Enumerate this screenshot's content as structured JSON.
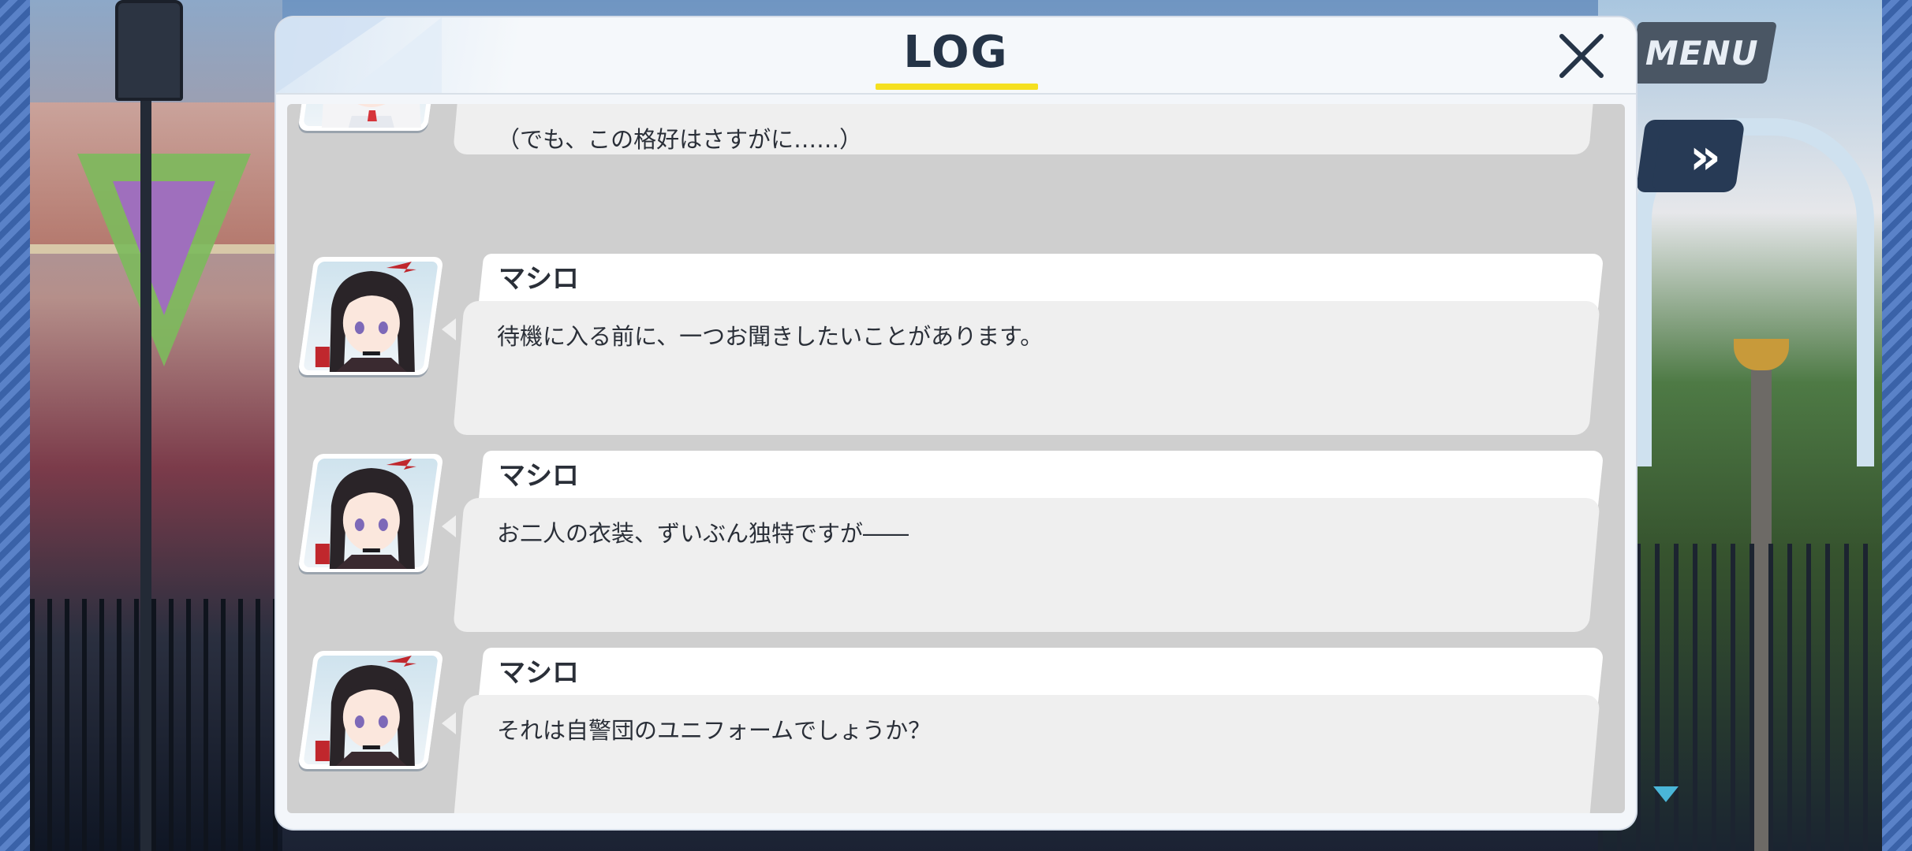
{
  "header": {
    "title": "LOG",
    "close_icon": "close-icon"
  },
  "hud": {
    "menu_label": "MENU",
    "skip_label": "»",
    "skip_icon": "fast-forward-icon",
    "auto_icon": "auto-icon",
    "scroll_icon": "scroll-down-icon"
  },
  "log": {
    "entries": [
      {
        "speaker": "",
        "text": "（でも、この格好はさすがに……）",
        "portrait": "white-haired-character-portrait"
      },
      {
        "speaker": "マシロ",
        "text": "待機に入る前に、一つお聞きしたいことがあります。",
        "portrait": "mashiro-portrait"
      },
      {
        "speaker": "マシロ",
        "text": "お二人の衣装、ずいぶん独特ですが――",
        "portrait": "mashiro-portrait"
      },
      {
        "speaker": "マシロ",
        "text": "それは自警団のユニフォームでしょうか？",
        "portrait": "mashiro-portrait"
      }
    ]
  },
  "colors": {
    "accent_underline": "#f5e020",
    "title_text": "#253447",
    "bubble": "#efefef",
    "log_background": "#cfcfcf"
  }
}
